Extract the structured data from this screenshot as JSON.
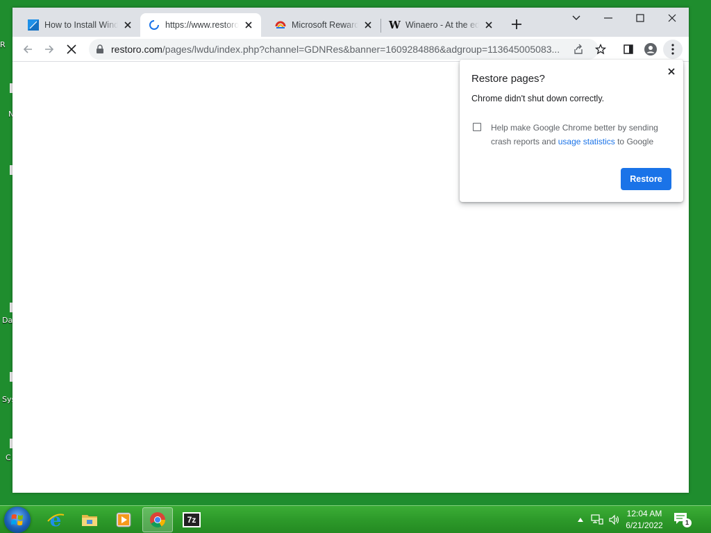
{
  "desktop": {
    "labels": [
      "R",
      "N",
      "Da",
      "Sys",
      "C"
    ]
  },
  "browser": {
    "tabs": [
      {
        "title": "How to Install Windows",
        "favicon": "winaero-blue-icon",
        "active": false
      },
      {
        "title": "https://www.restoro.com",
        "favicon": "loading-spinner-icon",
        "active": true
      },
      {
        "title": "Microsoft Rewards - ",
        "favicon": "rewards-icon",
        "active": false
      },
      {
        "title": "Winaero - At the edge",
        "favicon": "winaero-w-icon",
        "active": false
      }
    ],
    "address": {
      "host": "restoro.com",
      "path": "/pages/lwdu/index.php?channel=GDNRes&banner=1609284886&adgroup=113645005083..."
    }
  },
  "dialog": {
    "title": "Restore pages?",
    "message": "Chrome didn't shut down correctly.",
    "help_prefix": "Help make Google Chrome better by sending crash reports and ",
    "help_link": "usage statistics",
    "help_suffix": " to Google",
    "checkbox_checked": false,
    "button_label": "Restore",
    "accent_color": "#1a73e8"
  },
  "taskbar": {
    "apps": [
      "internet-explorer-icon",
      "file-explorer-icon",
      "media-player-icon",
      "chrome-icon",
      "7zip-icon"
    ],
    "active_app": "chrome-icon",
    "app_7zip_label": "7z",
    "time": "12:04 AM",
    "date": "6/21/2022",
    "notification_count": "1",
    "color": "#2d9a2a"
  }
}
